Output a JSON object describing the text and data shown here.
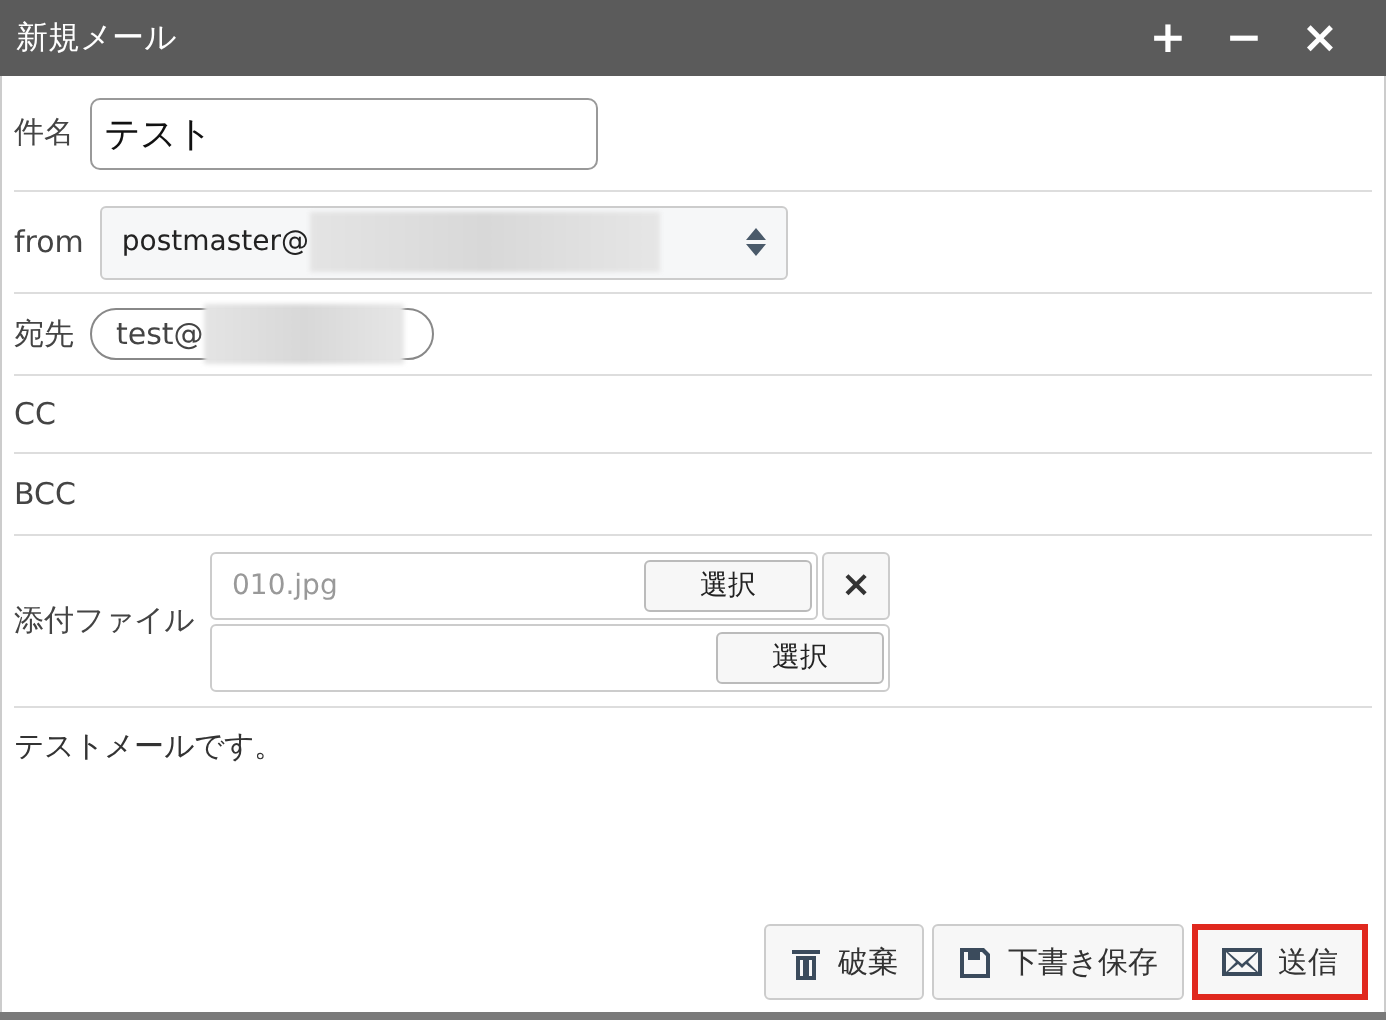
{
  "window": {
    "title": "新規メール",
    "controls": [
      "+",
      "−",
      "×"
    ]
  },
  "subject": {
    "label": "件名",
    "value": "テスト"
  },
  "from": {
    "label": "from",
    "value": "postmaster@"
  },
  "to": {
    "label": "宛先",
    "chip": "test@"
  },
  "cc": {
    "label": "CC"
  },
  "bcc": {
    "label": "BCC"
  },
  "attachments": {
    "label": "添付ファイル",
    "files": [
      {
        "name": "010.jpg",
        "button": "選択",
        "remove": "×"
      },
      {
        "button": "選択"
      }
    ]
  },
  "body": "テストメールです。",
  "buttons": [
    {
      "kind": "trash",
      "label": "破棄",
      "highlighted": false
    },
    {
      "kind": "save",
      "label": "下書き保存",
      "highlighted": false
    },
    {
      "kind": "mail",
      "label": "送信",
      "highlighted": true
    }
  ]
}
